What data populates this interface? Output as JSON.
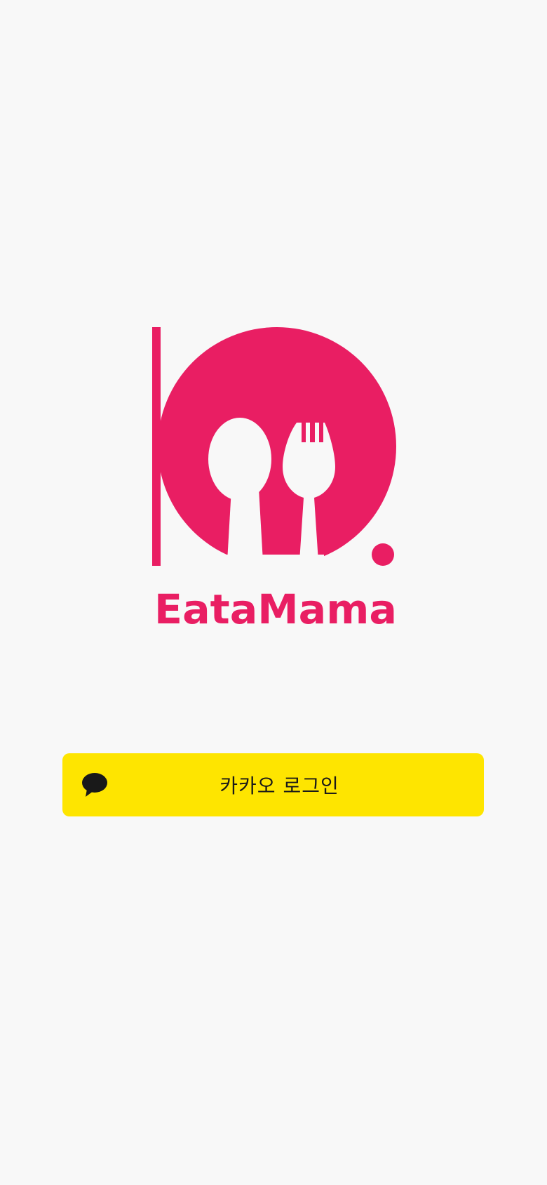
{
  "app": {
    "brand_name": "EataMama",
    "brand_color": "#e91e63",
    "background_color": "#f8f8f8"
  },
  "logo": {
    "icon": "plate-spoon-fork-icon",
    "wordmark": "EataMama"
  },
  "login": {
    "kakao_label": "카카오 로그인",
    "kakao_icon": "kakao-speech-bubble-icon",
    "kakao_color": "#fee500",
    "kakao_text_color": "#191919"
  }
}
